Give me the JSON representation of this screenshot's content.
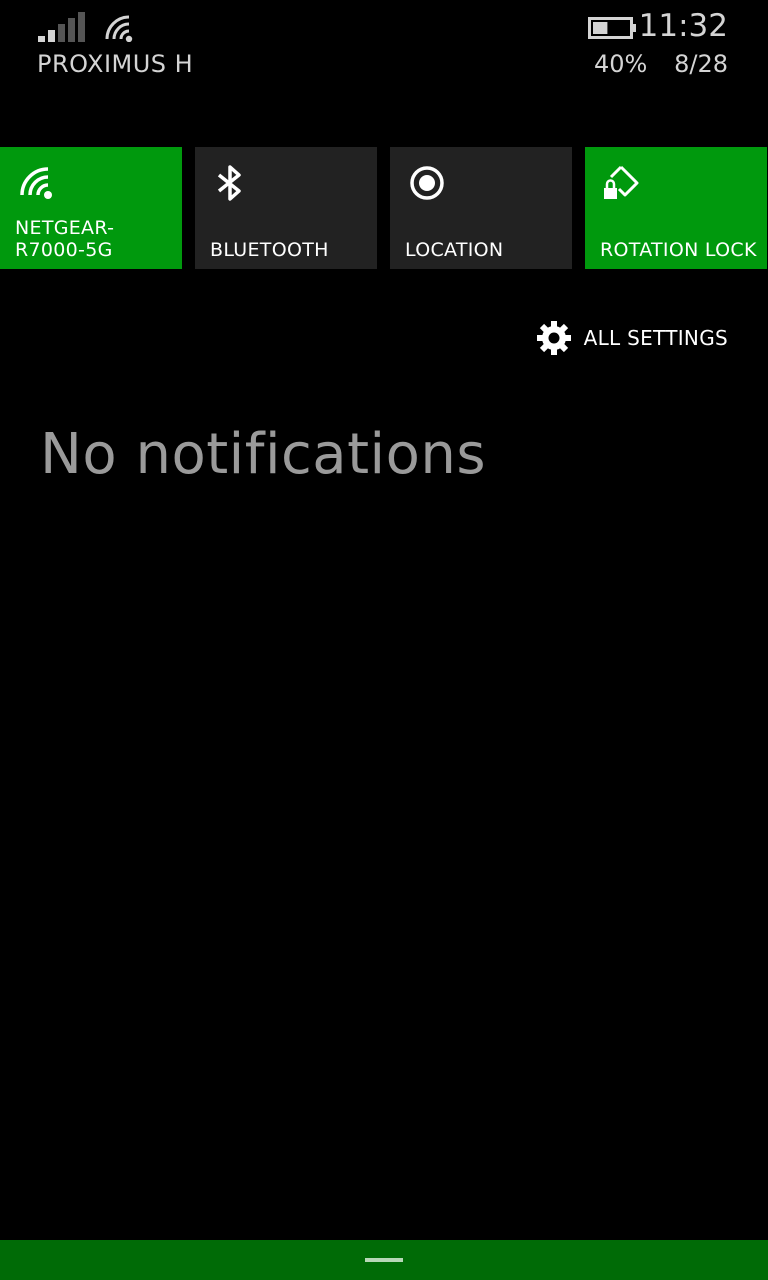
{
  "theme": {
    "accent": "#00990d",
    "tile_off": "#222222",
    "bottom_bar": "#006b06"
  },
  "status_bar": {
    "carrier": "PROXIMUS H",
    "time": "11:32",
    "battery_percent": "40%",
    "battery_level": 0.4,
    "date": "8/28",
    "signal_icon": "cell-signal-icon",
    "wifi_icon": "wifi-icon",
    "battery_icon": "battery-icon"
  },
  "quick_actions": [
    {
      "label": "NETGEAR-\nR7000-5G",
      "icon": "wifi-icon",
      "state": "on"
    },
    {
      "label": "BLUETOOTH",
      "icon": "bluetooth-icon",
      "state": "off"
    },
    {
      "label": "LOCATION",
      "icon": "location-icon",
      "state": "off"
    },
    {
      "label": "ROTATION LOCK",
      "icon": "rotation-lock-icon",
      "state": "on"
    }
  ],
  "all_settings": {
    "label": "ALL SETTINGS",
    "icon": "gear-icon"
  },
  "notifications": {
    "empty_message": "No notifications"
  },
  "bottom_bar": {
    "handle_icon": "drag-handle-icon"
  }
}
